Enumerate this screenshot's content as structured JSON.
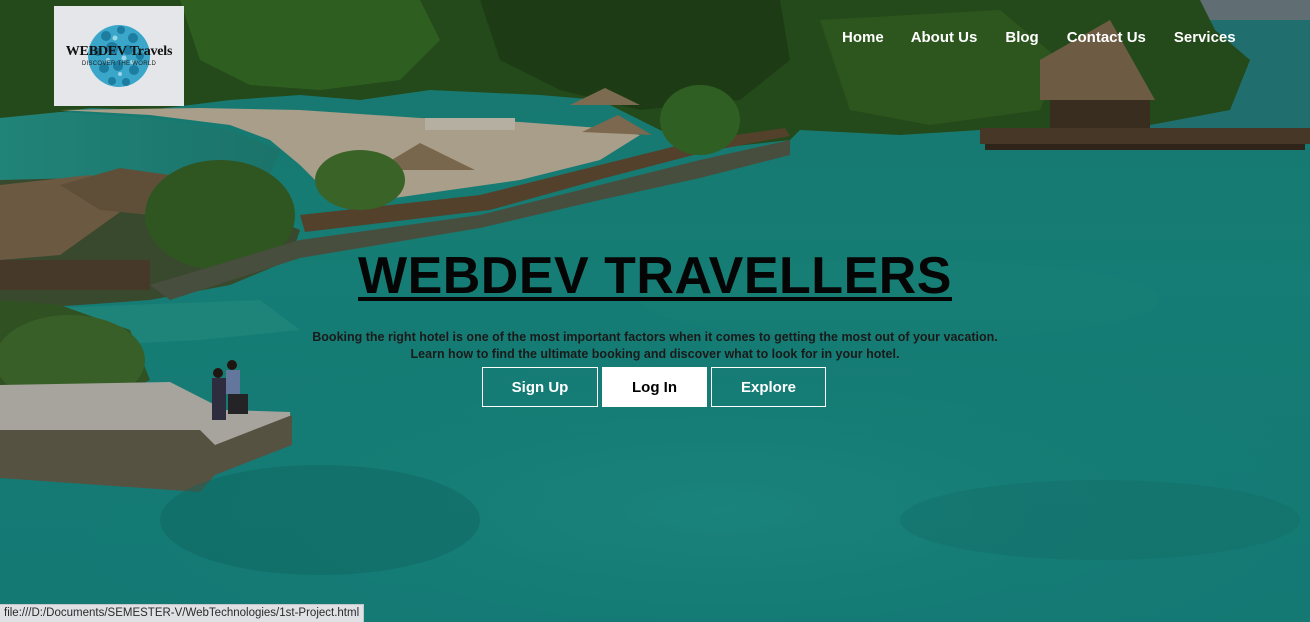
{
  "logo": {
    "brand": "WEBDEV Travels",
    "tagline": "DISCOVER THE WORLD"
  },
  "nav": {
    "items": [
      {
        "label": "Home"
      },
      {
        "label": "About Us"
      },
      {
        "label": "Blog"
      },
      {
        "label": "Contact Us"
      },
      {
        "label": "Services"
      }
    ]
  },
  "hero": {
    "title": "WEBDEV TRAVELLERS",
    "line1": "Booking the right hotel is one of the most important factors when it comes to getting the most out of your vacation.",
    "line2": "Learn how to find the ultimate booking and discover what to look for in your hotel."
  },
  "buttons": {
    "signup": "Sign Up",
    "login": "Log In",
    "explore": "Explore"
  },
  "status_bar": {
    "url": "file:///D:/Documents/SEMESTER-V/WebTechnologies/1st-Project.html"
  },
  "colors": {
    "water": "#1e9c90",
    "jungle": "#2f5e22",
    "sand": "#d9cbb0",
    "button_border": "#ffffff",
    "title_text": "#050505"
  }
}
